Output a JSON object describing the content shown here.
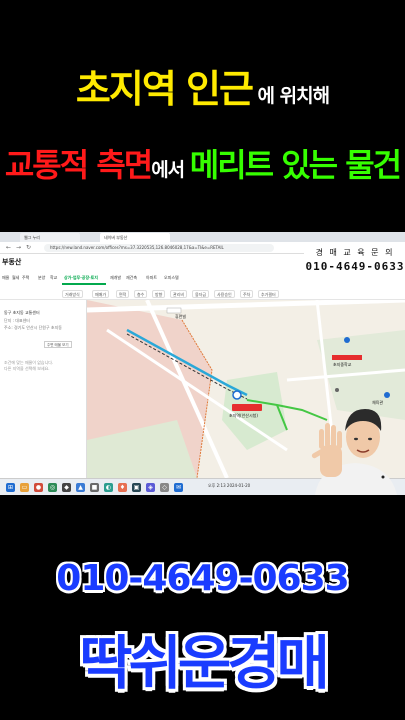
{
  "headline": {
    "line1_big": "초지역 인근",
    "line1_small": "에 위치해",
    "line2_red": "교통적 측면",
    "line2_small": "에서",
    "line2_green": "메리트 있는 물건"
  },
  "browser": {
    "tabs": [
      "웹그 누리",
      "네이버 부동산"
    ],
    "url": "https://new.land.naver.com/offices?ms=37.3220535,126.8046028,17&a=TI&e=RETAIL"
  },
  "overlay": {
    "label": "경 매 교 육 문 의",
    "phone": "010-4649-0633"
  },
  "site": {
    "logo": "부동산",
    "menu": [
      "매물",
      "월세",
      "주택",
      "분양",
      "학교",
      "상가·업무·공장·토지",
      "재개발",
      "재건축",
      "아파트",
      "오피스텔"
    ],
    "active_menu_index": 5,
    "filters": [
      "거래방식",
      "매매가",
      "면적",
      "층수",
      "방향",
      "관리비",
      "융자금",
      "사용승인",
      "주차",
      "추가필터"
    ]
  },
  "left_panel": {
    "line1": "동구 초지동 교통센터",
    "line2": "단지 : 대표센터",
    "line3": "주소: 경기도 안산시 단원구 초지동",
    "button": "주변 매물 보기",
    "note1": "조건에 맞는 매물이 없습니다.",
    "note2": "다른 지역을 선택해 보세요."
  },
  "map": {
    "labels": {
      "station": "초지역",
      "station_sub": "(안산시청)",
      "school": "초지중학교",
      "apartment": "휴먼빌",
      "gym": "체육관"
    }
  },
  "taskbar": {
    "time": "오후 2:13",
    "date": "2024-01-20"
  },
  "bottom": {
    "phone": "010-4649-0633",
    "brand": "딱쉬운경매"
  },
  "colors": {
    "headline_yellow": "#ffea00",
    "headline_red": "#ff1a1a",
    "headline_green": "#36ff00",
    "brand_blue": "#1a3cff",
    "naver_green": "#03a94d"
  }
}
